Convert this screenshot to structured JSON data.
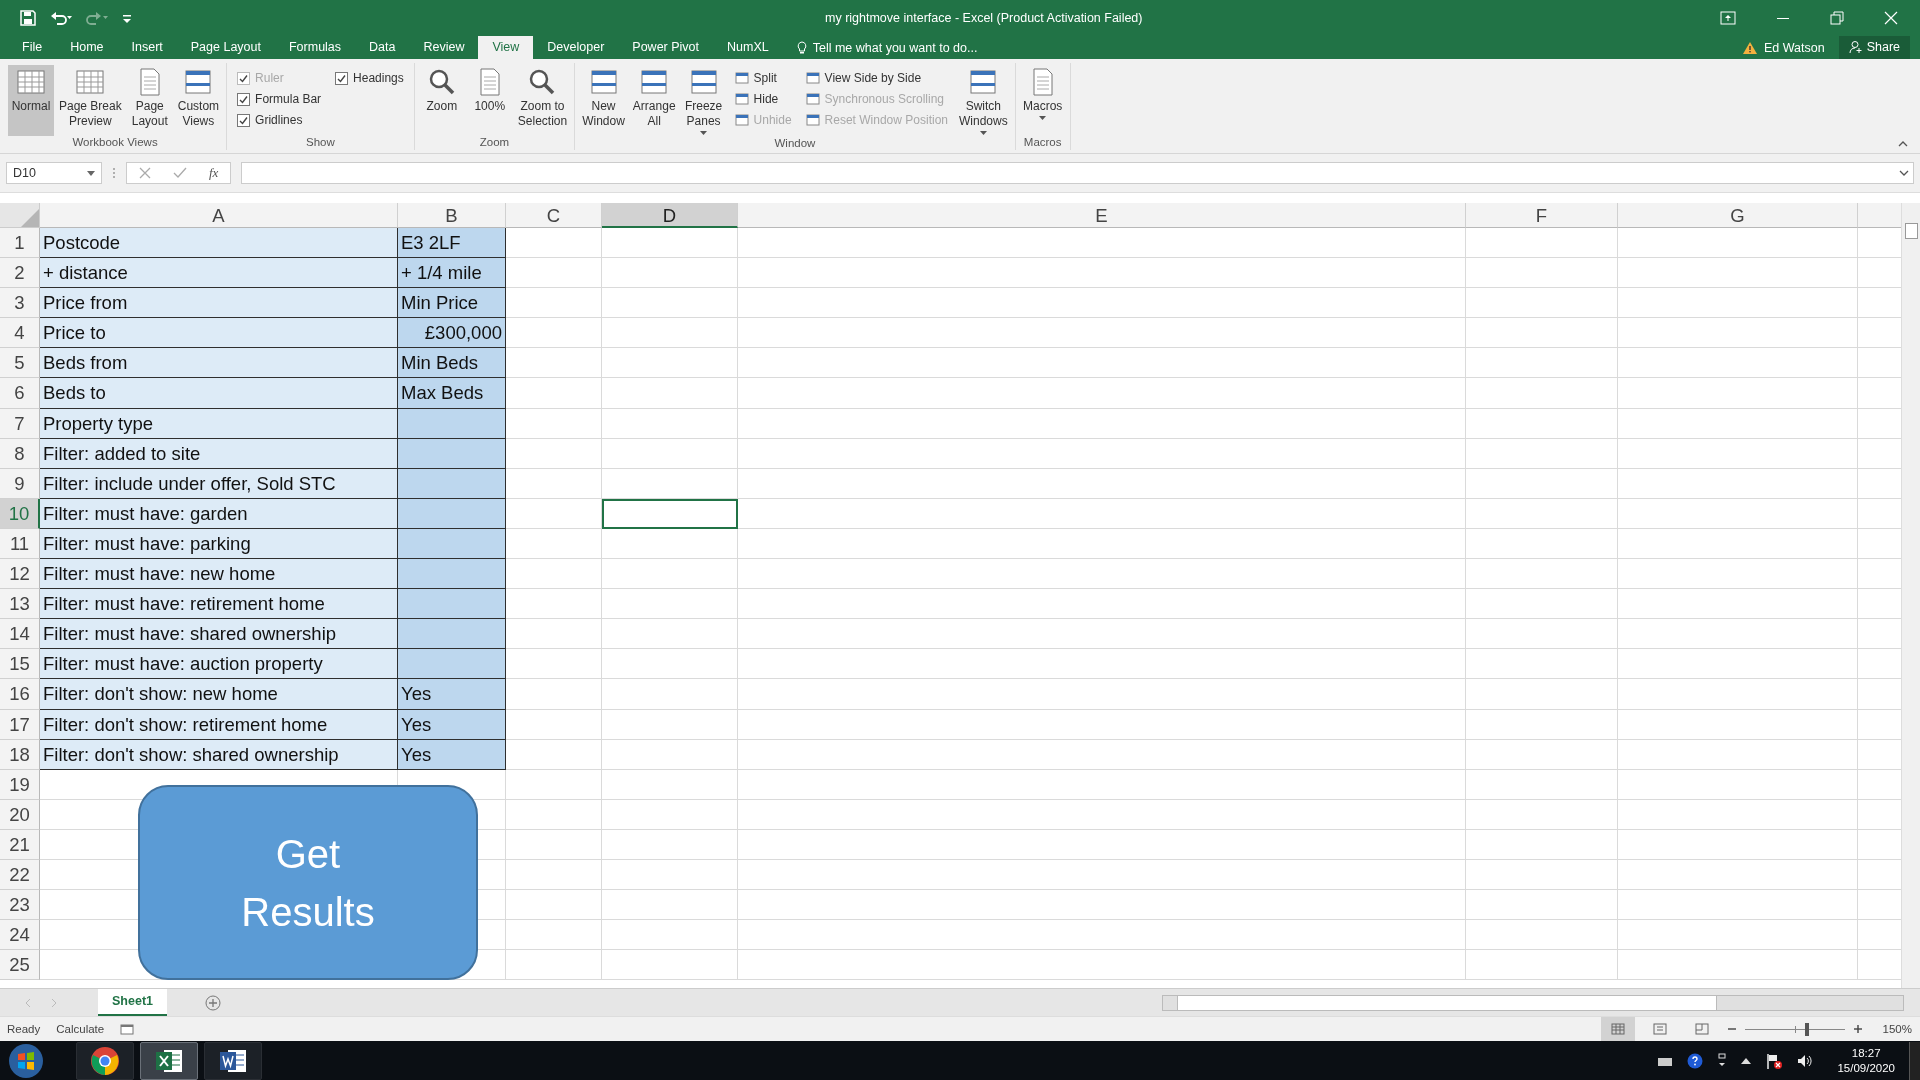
{
  "window": {
    "title": "my rightmove interface - Excel (Product Activation Failed)"
  },
  "ribbon_tabs": [
    {
      "label": "File",
      "selected": false
    },
    {
      "label": "Home",
      "selected": false
    },
    {
      "label": "Insert",
      "selected": false
    },
    {
      "label": "Page Layout",
      "selected": false
    },
    {
      "label": "Formulas",
      "selected": false
    },
    {
      "label": "Data",
      "selected": false
    },
    {
      "label": "Review",
      "selected": false
    },
    {
      "label": "View",
      "selected": true
    },
    {
      "label": "Developer",
      "selected": false
    },
    {
      "label": "Power Pivot",
      "selected": false
    },
    {
      "label": "NumXL",
      "selected": false
    }
  ],
  "tell_me": {
    "placeholder": "Tell me what you want to do..."
  },
  "account": {
    "user": "Ed Watson",
    "share": "Share"
  },
  "ribbon_groups": [
    {
      "label": "Workbook Views",
      "items": [
        {
          "kind": "large",
          "label": "Normal",
          "selected": true
        },
        {
          "kind": "large",
          "label": "Page Break\nPreview",
          "selected": false
        },
        {
          "kind": "large",
          "label": "Page\nLayout",
          "selected": false
        },
        {
          "kind": "large",
          "label": "Custom\nViews",
          "selected": false
        }
      ]
    },
    {
      "label": "Show",
      "items": [
        {
          "kind": "check",
          "label": "Ruler",
          "checked": true,
          "disabled": true
        },
        {
          "kind": "check",
          "label": "Formula Bar",
          "checked": true,
          "disabled": false
        },
        {
          "kind": "check",
          "label": "Gridlines",
          "checked": true,
          "disabled": false
        },
        {
          "kind": "check",
          "label": "Headings",
          "checked": true,
          "disabled": false
        }
      ]
    },
    {
      "label": "Zoom",
      "items": [
        {
          "kind": "large",
          "label": "Zoom",
          "selected": false
        },
        {
          "kind": "large",
          "label": "100%",
          "selected": false
        },
        {
          "kind": "large",
          "label": "Zoom to\nSelection",
          "selected": false
        }
      ]
    },
    {
      "label": "Window",
      "items": [
        {
          "kind": "large",
          "label": "New\nWindow",
          "selected": false
        },
        {
          "kind": "large",
          "label": "Arrange\nAll",
          "selected": false
        },
        {
          "kind": "large",
          "label": "Freeze\nPanes",
          "selected": false,
          "dropdown": true
        },
        {
          "kind": "small",
          "label": "Split",
          "disabled": false
        },
        {
          "kind": "small",
          "label": "Hide",
          "disabled": false
        },
        {
          "kind": "small",
          "label": "Unhide",
          "disabled": true
        },
        {
          "kind": "small",
          "label": "View Side by Side",
          "disabled": false
        },
        {
          "kind": "small",
          "label": "Synchronous Scrolling",
          "disabled": true
        },
        {
          "kind": "small",
          "label": "Reset Window Position",
          "disabled": true
        },
        {
          "kind": "large",
          "label": "Switch\nWindows",
          "selected": false,
          "dropdown": true
        }
      ]
    },
    {
      "label": "Macros",
      "items": [
        {
          "kind": "large",
          "label": "Macros",
          "selected": false,
          "dropdown": true
        }
      ]
    }
  ],
  "formula_bar": {
    "name_box": "D10",
    "fx": "fx"
  },
  "columns": [
    {
      "label": "A",
      "selected": false
    },
    {
      "label": "B",
      "selected": false
    },
    {
      "label": "C",
      "selected": false
    },
    {
      "label": "D",
      "selected": true
    },
    {
      "label": "E",
      "selected": false
    },
    {
      "label": "F",
      "selected": false
    },
    {
      "label": "G",
      "selected": false
    }
  ],
  "rows": [
    {
      "number": "1",
      "selected": false,
      "a": "Postcode",
      "b": "E3 2LF"
    },
    {
      "number": "2",
      "selected": false,
      "a": "+ distance",
      "b": "+ 1/4 mile"
    },
    {
      "number": "3",
      "selected": false,
      "a": "Price from",
      "b": "Min Price"
    },
    {
      "number": "4",
      "selected": false,
      "a": "Price to",
      "b": "£300,000",
      "b_right": true
    },
    {
      "number": "5",
      "selected": false,
      "a": "Beds from",
      "b": "Min Beds"
    },
    {
      "number": "6",
      "selected": false,
      "a": "Beds to",
      "b": "Max Beds"
    },
    {
      "number": "7",
      "selected": false,
      "a": "Property type"
    },
    {
      "number": "8",
      "selected": false,
      "a": "Filter: added to site"
    },
    {
      "number": "9",
      "selected": false,
      "a": "Filter: include under offer, Sold STC"
    },
    {
      "number": "10",
      "selected": true,
      "a": "Filter: must have: garden"
    },
    {
      "number": "11",
      "selected": false,
      "a": "Filter: must have: parking"
    },
    {
      "number": "12",
      "selected": false,
      "a": "Filter: must have: new home"
    },
    {
      "number": "13",
      "selected": false,
      "a": "Filter: must have: retirement home"
    },
    {
      "number": "14",
      "selected": false,
      "a": "Filter: must have: shared ownership"
    },
    {
      "number": "15",
      "selected": false,
      "a": "Filter: must have: auction property"
    },
    {
      "number": "16",
      "selected": false,
      "a": "Filter: don't show: new home",
      "b": "Yes"
    },
    {
      "number": "17",
      "selected": false,
      "a": "Filter: don't show: retirement home",
      "b": "Yes"
    },
    {
      "number": "18",
      "selected": false,
      "a": "Filter: don't show: shared ownership",
      "b": "Yes"
    },
    {
      "number": "19",
      "selected": false
    },
    {
      "number": "20",
      "selected": false
    },
    {
      "number": "21",
      "selected": false
    },
    {
      "number": "22",
      "selected": false
    },
    {
      "number": "23",
      "selected": false
    },
    {
      "number": "24",
      "selected": false
    },
    {
      "number": "25",
      "selected": false
    }
  ],
  "shape_button": {
    "label": "Get Results"
  },
  "sheet_tabs": [
    {
      "label": "Sheet1",
      "selected": true
    }
  ],
  "status_bar": {
    "mode": "Ready",
    "calculate": "Calculate",
    "views": [
      {
        "selected": true
      },
      {
        "selected": false
      },
      {
        "selected": false
      }
    ],
    "zoom_slider": {
      "level": 0.62
    },
    "zoom": "150%"
  },
  "taskbar": {
    "apps": [
      {
        "selected": false
      },
      {
        "selected": true
      },
      {
        "selected": false
      }
    ],
    "time": "18:27",
    "date": "15/09/2020"
  }
}
